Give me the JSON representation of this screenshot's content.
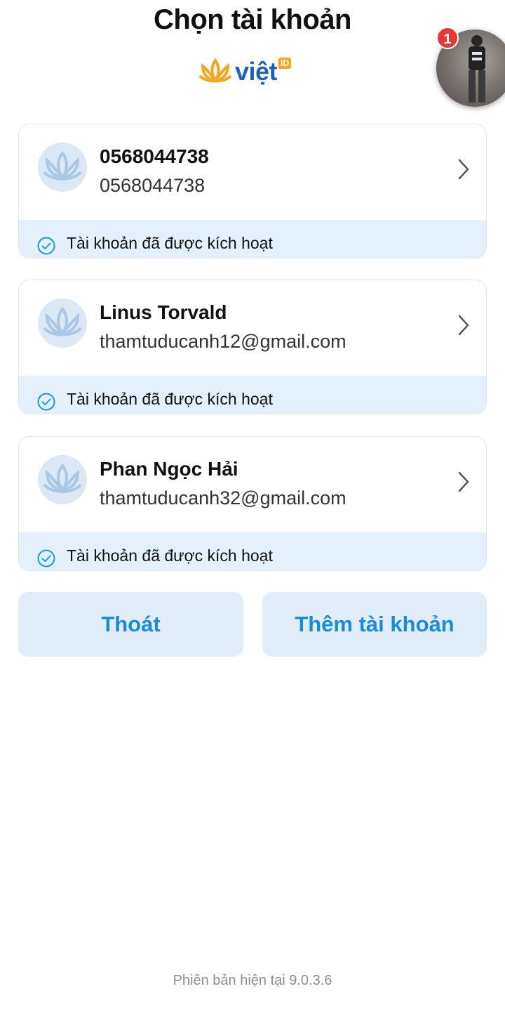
{
  "header": {
    "title": "Chọn tài khoản",
    "logo_text": "việt",
    "logo_badge": "ID"
  },
  "notification": {
    "count": "1"
  },
  "accounts": [
    {
      "name": "0568044738",
      "detail": "0568044738",
      "status": "Tài khoản đã được kích hoạt"
    },
    {
      "name": "Linus Torvald",
      "detail": "thamtuducanh12@gmail.com",
      "status": "Tài khoản đã được kích hoạt"
    },
    {
      "name": "Phan Ngọc Hải",
      "detail": "thamtuducanh32@gmail.com",
      "status": "Tài khoản đã được kích hoạt"
    }
  ],
  "buttons": {
    "exit_label": "Thoát",
    "add_label": "Thêm tài khoản"
  },
  "footer": {
    "version": "Phiên bản hiện tại 9.0.3.6"
  },
  "colors": {
    "accent": "#1b8ad8",
    "button_bg": "#e1eef9",
    "status_bg": "#e4f0fb",
    "logo_blue": "#1c63b7",
    "logo_orange": "#f5a623",
    "badge_red": "#e53935"
  }
}
